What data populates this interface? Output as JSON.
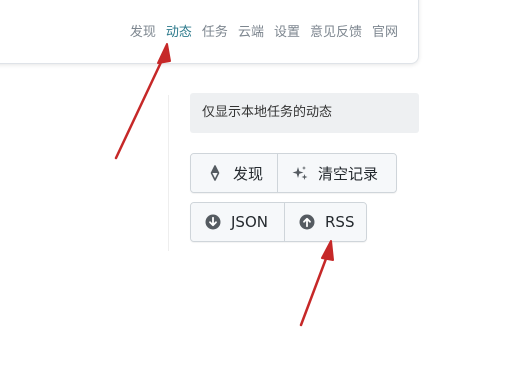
{
  "nav": {
    "items": [
      {
        "label": "发现",
        "active": false
      },
      {
        "label": "动态",
        "active": true
      },
      {
        "label": "任务",
        "active": false
      },
      {
        "label": "云端",
        "active": false
      },
      {
        "label": "设置",
        "active": false
      },
      {
        "label": "意见反馈",
        "active": false
      },
      {
        "label": "官网",
        "active": false
      }
    ]
  },
  "notice": {
    "text": "仅显示本地任务的动态"
  },
  "actions": {
    "discover": {
      "label": "发现",
      "icon": "compass-icon"
    },
    "clear": {
      "label": "清空记录",
      "icon": "sparkle-icon"
    },
    "json": {
      "label": "JSON",
      "icon": "download-circle-icon"
    },
    "rss": {
      "label": "RSS",
      "icon": "upload-circle-icon"
    }
  },
  "colors": {
    "active_nav": "#2d7a8c",
    "nav_text": "#7d868f",
    "arrow": "#c62828"
  }
}
